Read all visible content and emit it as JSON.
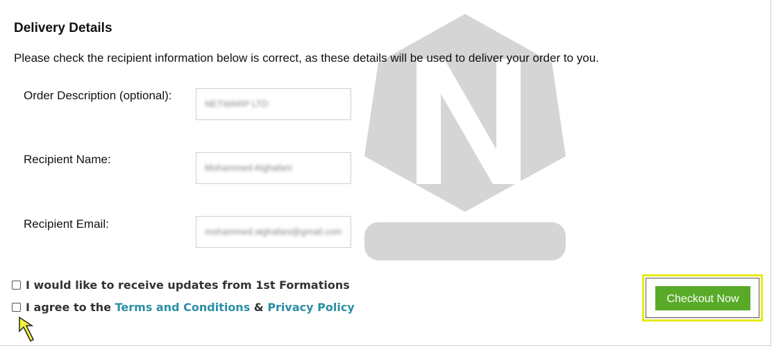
{
  "header": {
    "title": "Delivery Details"
  },
  "intro": "Please check the recipient information below is correct, as these details will be used to deliver your order to you.",
  "fields": [
    {
      "label": "Order Description (optional):",
      "value": "NETWARP LTD"
    },
    {
      "label": "Recipient Name:",
      "value": "Mohammed Alghafani"
    },
    {
      "label": "Recipient Email:",
      "value": "mohammed.alghafani@gmail.com"
    }
  ],
  "checkboxes": {
    "updates": {
      "label": "I would like to receive updates from 1st Formations",
      "checked": false
    },
    "agree": {
      "prefix": "I agree to the ",
      "terms": "Terms and Conditions",
      "amp": " & ",
      "privacy": "Privacy Policy",
      "checked": false
    }
  },
  "checkout": {
    "label": "Checkout Now"
  },
  "colors": {
    "accent_green": "#5aaa2a",
    "link": "#2a8fa6",
    "highlight": "#e8ea12"
  }
}
